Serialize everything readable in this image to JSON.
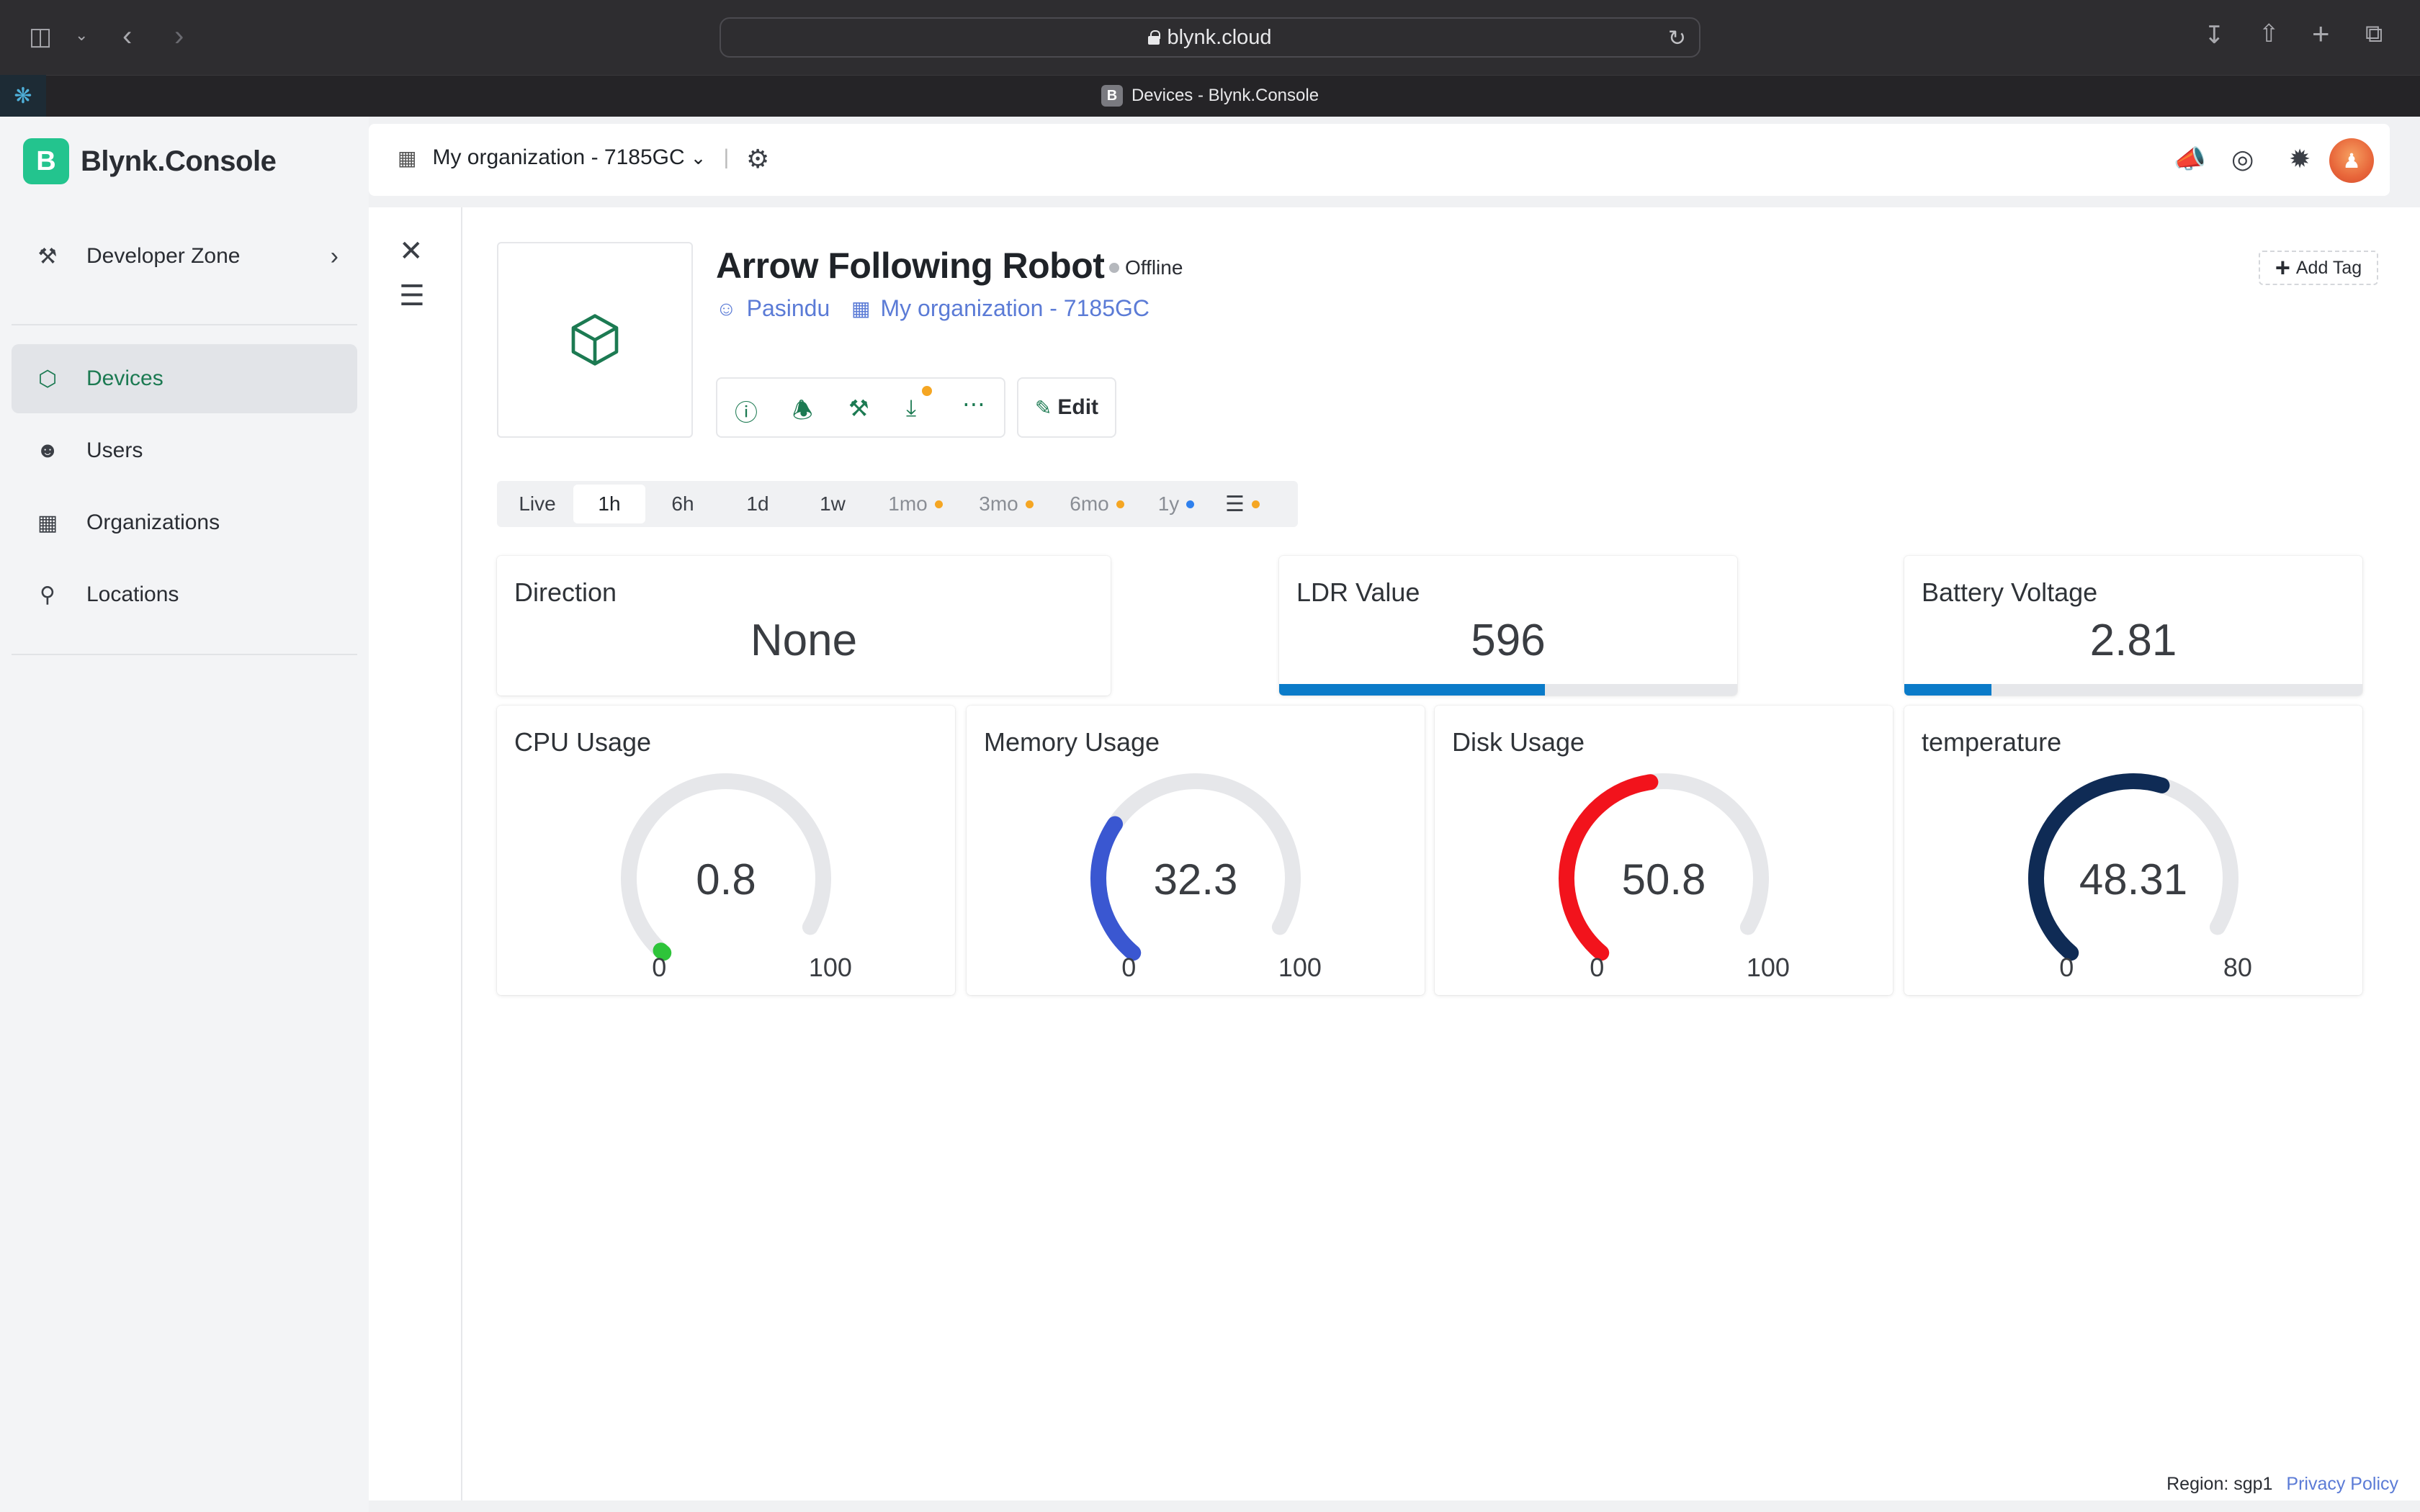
{
  "browser": {
    "url": "blynk.cloud",
    "tab_title": "Devices - Blynk.Console",
    "tab_favicon": "B"
  },
  "brand": {
    "logo_letter": "B",
    "name": "Blynk.Console",
    "color": "#23c48e"
  },
  "sidebar": {
    "developer_zone": "Developer Zone",
    "items": [
      {
        "label": "Devices",
        "icon": "cube-icon",
        "active": true
      },
      {
        "label": "Users",
        "icon": "users-icon"
      },
      {
        "label": "Organizations",
        "icon": "building-icon"
      },
      {
        "label": "Locations",
        "icon": "location-pin-icon"
      }
    ]
  },
  "header": {
    "organization": "My organization - 7185GC"
  },
  "device": {
    "name": "Arrow Following Robot",
    "status": "Offline",
    "owner": "Pasindu",
    "organization": "My organization - 7185GC",
    "edit_label": "Edit",
    "add_tag_label": "Add Tag"
  },
  "time_ranges": [
    {
      "label": "Live"
    },
    {
      "label": "1h",
      "active": true
    },
    {
      "label": "6h"
    },
    {
      "label": "1d"
    },
    {
      "label": "1w"
    },
    {
      "label": "1mo",
      "dot": "#f5a623",
      "muted": true
    },
    {
      "label": "3mo",
      "dot": "#f5a623",
      "muted": true
    },
    {
      "label": "6mo",
      "dot": "#f5a623",
      "muted": true
    },
    {
      "label": "1y",
      "dot": "#2f80ed",
      "muted": true
    }
  ],
  "widgets": {
    "direction": {
      "title": "Direction",
      "value": "None"
    },
    "ldr": {
      "title": "LDR Value",
      "value": "596",
      "bar_fraction": 0.58,
      "color": "#0a7bc9"
    },
    "battery": {
      "title": "Battery Voltage",
      "value": "2.81",
      "bar_fraction": 0.19,
      "color": "#0a7bc9"
    },
    "cpu": {
      "title": "CPU Usage",
      "value": "0.8",
      "min": "0",
      "max": "100",
      "numeric": 0.8,
      "range": 100,
      "color": "#2ec43a"
    },
    "memory": {
      "title": "Memory Usage",
      "value": "32.3",
      "min": "0",
      "max": "100",
      "numeric": 32.3,
      "range": 100,
      "color": "#3a57d1"
    },
    "disk": {
      "title": "Disk Usage",
      "value": "50.8",
      "min": "0",
      "max": "100",
      "numeric": 50.8,
      "range": 100,
      "color": "#f2131c"
    },
    "temperature": {
      "title": "temperature",
      "value": "48.31",
      "min": "0",
      "max": "80",
      "numeric": 48.31,
      "range": 80,
      "color": "#0f2b55"
    }
  },
  "footer": {
    "region": "Region: sgp1",
    "privacy": "Privacy Policy"
  }
}
